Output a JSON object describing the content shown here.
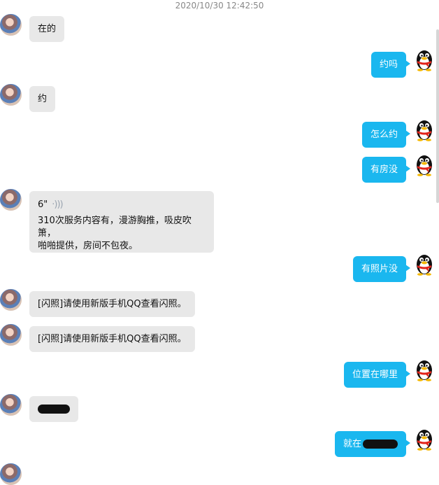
{
  "timestamp": "2020/10/30 12:42:50",
  "messages": [
    {
      "side": "in",
      "text": "在的"
    },
    {
      "side": "out",
      "text": "约吗"
    },
    {
      "side": "in",
      "text": "约"
    },
    {
      "side": "out",
      "text": "怎么约"
    },
    {
      "side": "out",
      "text": "有房没"
    },
    {
      "side": "in",
      "type": "voice",
      "duration": "6\"",
      "transcript_line1": "310次服务内容有，漫游胸推，吸皮吹箫，",
      "transcript_line2": "啪啪提供，房间不包夜。"
    },
    {
      "side": "out",
      "text": "有照片没"
    },
    {
      "side": "in",
      "text": "[闪照]请使用新版手机QQ查看闪照。"
    },
    {
      "side": "in",
      "text": "[闪照]请使用新版手机QQ查看闪照。"
    },
    {
      "side": "out",
      "text": "位置在哪里"
    },
    {
      "side": "in",
      "type": "redacted"
    },
    {
      "side": "out",
      "text": "就在"
    }
  ],
  "colors": {
    "outgoing_bubble": "#1ab7ef",
    "incoming_bubble": "#e8e8e8"
  },
  "icons": {
    "left_avatar": "contact-avatar-photo",
    "right_avatar": "qq-penguin-avatar"
  }
}
